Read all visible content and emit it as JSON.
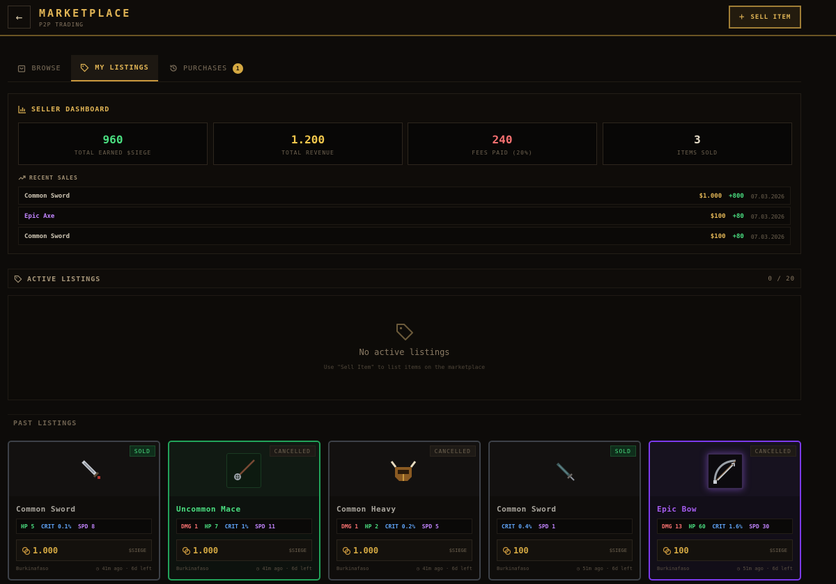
{
  "header": {
    "title": "MARKETPLACE",
    "subtitle": "P2P TRADING",
    "back_icon": "arrow-left-icon",
    "sell_label": "SELL ITEM"
  },
  "tabs": [
    {
      "label": "BROWSE",
      "icon": "bag-icon"
    },
    {
      "label": "MY LISTINGS",
      "icon": "tag-icon",
      "active": true
    },
    {
      "label": "PURCHASES",
      "icon": "history-icon",
      "badge": "1"
    }
  ],
  "dashboard": {
    "title": "SELLER DASHBOARD",
    "stats": [
      {
        "value": "960",
        "label": "TOTAL EARNED $SIEGE",
        "color": "#4ade80"
      },
      {
        "value": "1.200",
        "label": "TOTAL REVENUE",
        "color": "#f0c64c"
      },
      {
        "value": "240",
        "label": "FEES PAID (20%)",
        "color": "#f87171"
      },
      {
        "value": "3",
        "label": "ITEMS SOLD",
        "color": "#e5dcc8"
      }
    ],
    "recent_title": "RECENT SALES",
    "sales": [
      {
        "name": "Common Sword",
        "price": "$1.000",
        "gain": "+800",
        "date": "07.03.2026",
        "color": "#cfc6b4"
      },
      {
        "name": "Epic Axe",
        "price": "$100",
        "gain": "+80",
        "date": "07.03.2026",
        "color": "#c084fc"
      },
      {
        "name": "Common Sword",
        "price": "$100",
        "gain": "+80",
        "date": "07.03.2026",
        "color": "#cfc6b4"
      }
    ]
  },
  "active": {
    "title": "ACTIVE LISTINGS",
    "count": "0 / 20",
    "empty_title": "No active listings",
    "empty_sub": "Use \"Sell Item\" to list items on the marketplace"
  },
  "past": {
    "title": "PAST LISTINGS",
    "cards": [
      {
        "name": "Common Sword",
        "status": "SOLD",
        "rarity": "common",
        "stats": [
          {
            "k": "HP",
            "v": "5"
          },
          {
            "k": "CRIT",
            "v": "0.1%"
          },
          {
            "k": "SPD",
            "v": "8"
          }
        ],
        "price": "1.000",
        "currency": "$SIEGE",
        "seller": "Burkinafaso",
        "time": "41m ago · 6d left"
      },
      {
        "name": "Uncommon Mace",
        "status": "CANCELLED",
        "rarity": "uncommon",
        "stats": [
          {
            "k": "DMG",
            "v": "1"
          },
          {
            "k": "HP",
            "v": "7"
          },
          {
            "k": "CRIT",
            "v": "1%"
          },
          {
            "k": "SPD",
            "v": "11"
          }
        ],
        "price": "1.000",
        "currency": "$SIEGE",
        "seller": "Burkinafaso",
        "time": "41m ago · 6d left"
      },
      {
        "name": "Common Heavy",
        "status": "CANCELLED",
        "rarity": "common",
        "stats": [
          {
            "k": "DMG",
            "v": "1"
          },
          {
            "k": "HP",
            "v": "2"
          },
          {
            "k": "CRIT",
            "v": "0.2%"
          },
          {
            "k": "SPD",
            "v": "5"
          }
        ],
        "price": "1.000",
        "currency": "$SIEGE",
        "seller": "Burkinafaso",
        "time": "41m ago · 6d left"
      },
      {
        "name": "Common Sword",
        "status": "SOLD",
        "rarity": "common",
        "stats": [
          {
            "k": "CRIT",
            "v": "0.4%"
          },
          {
            "k": "SPD",
            "v": "1"
          }
        ],
        "price": "100",
        "currency": "$SIEGE",
        "seller": "Burkinafaso",
        "time": "51m ago · 6d left"
      },
      {
        "name": "Epic Bow",
        "status": "CANCELLED",
        "rarity": "epic",
        "stats": [
          {
            "k": "DMG",
            "v": "13"
          },
          {
            "k": "HP",
            "v": "60"
          },
          {
            "k": "CRIT",
            "v": "1.6%"
          },
          {
            "k": "SPD",
            "v": "30"
          }
        ],
        "price": "100",
        "currency": "$SIEGE",
        "seller": "Burkinafaso",
        "time": "51m ago · 6d left"
      }
    ]
  },
  "colors": {
    "accent": "#e0b455",
    "dmg": "#f87171",
    "hp": "#4ade80",
    "crit": "#60a5fa",
    "spd": "#c084fc"
  }
}
